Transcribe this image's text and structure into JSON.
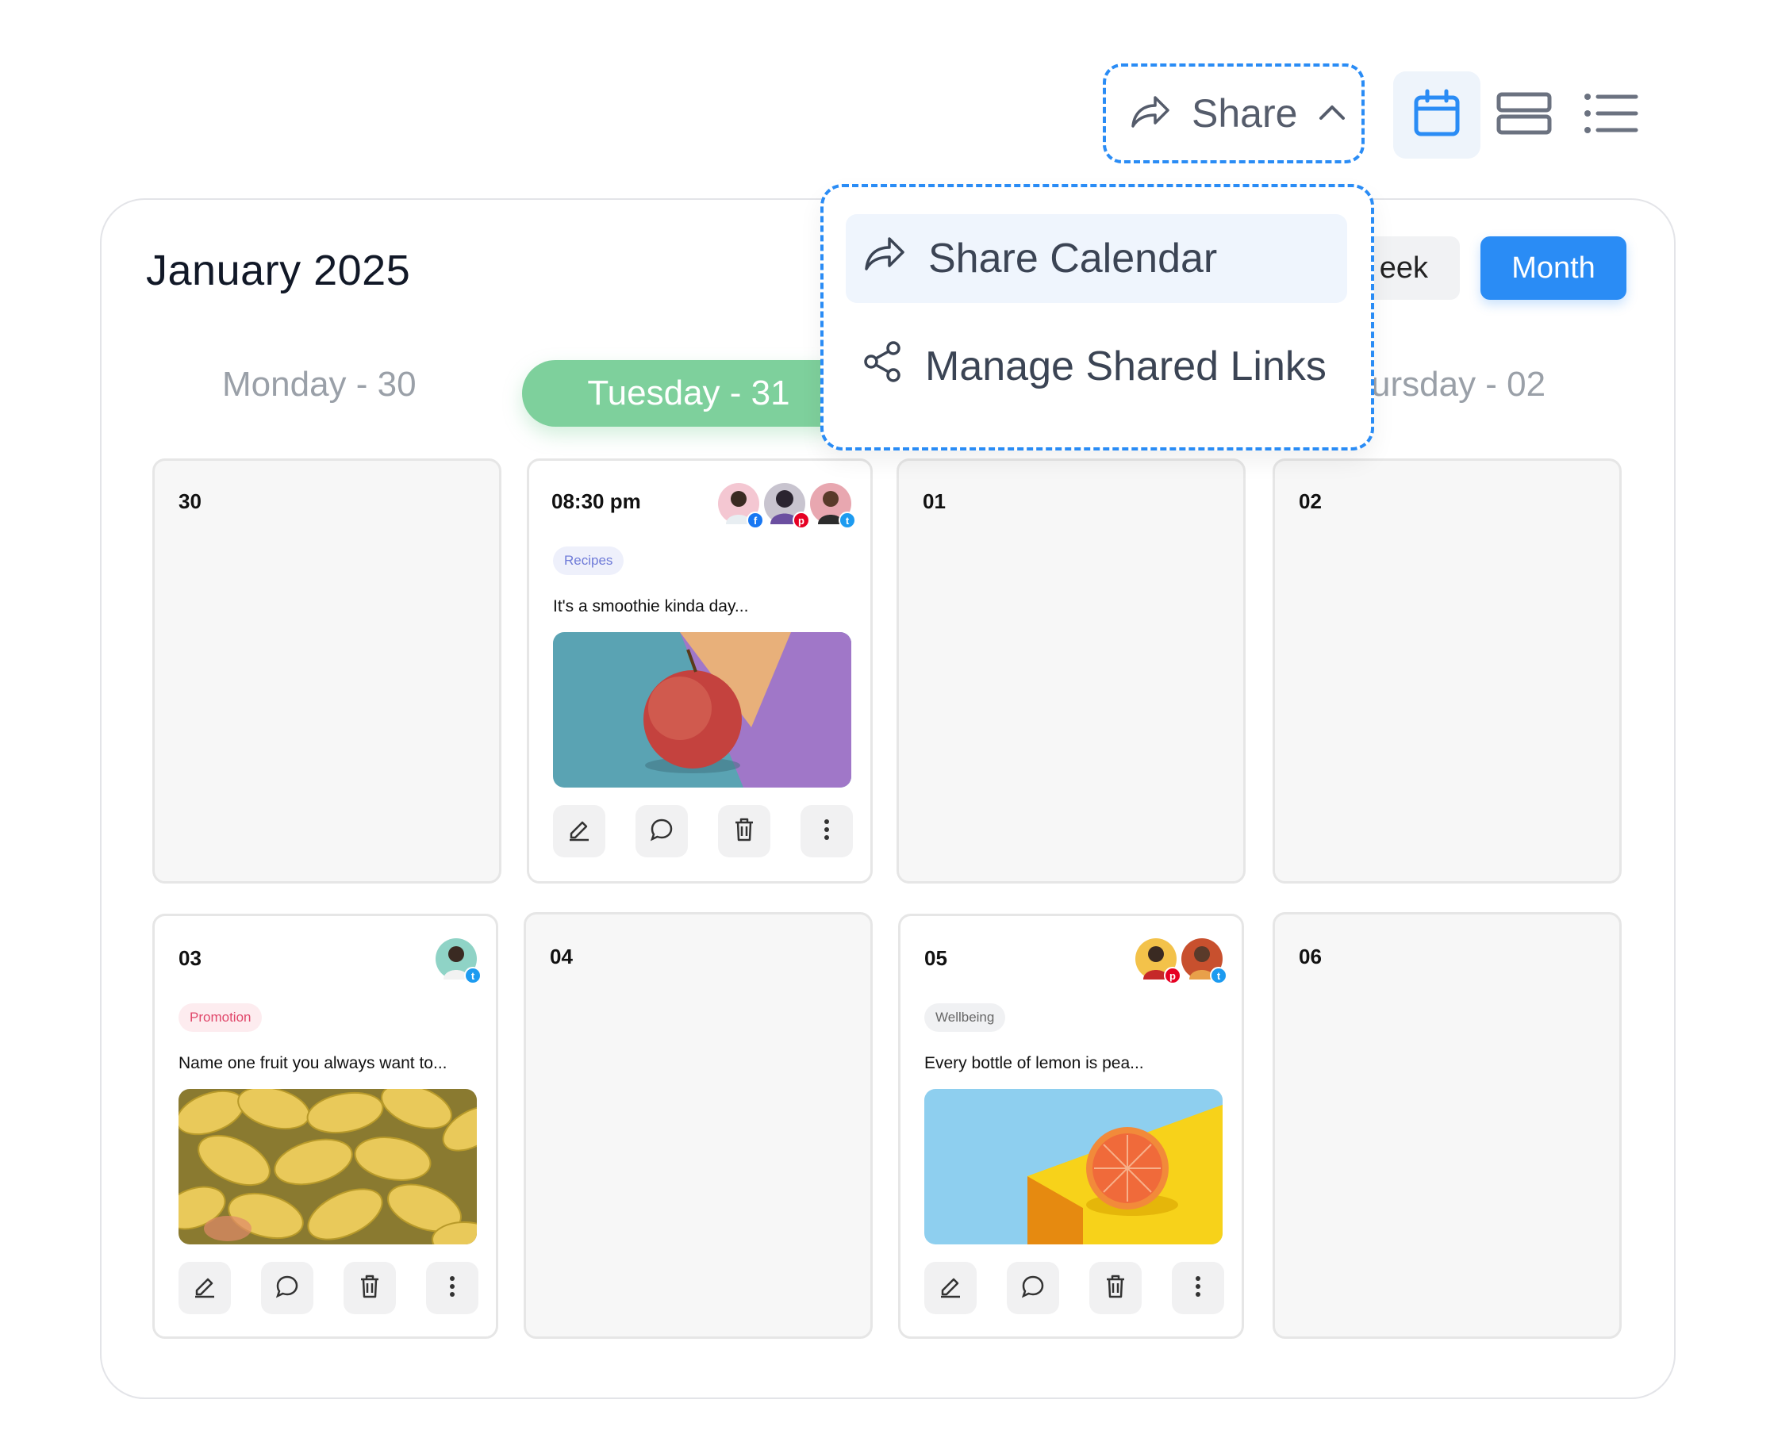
{
  "toolbar": {
    "share_label": "Share",
    "views": [
      "calendar-view",
      "stacked-view",
      "list-view"
    ],
    "active_view": "calendar-view"
  },
  "calendar": {
    "title": "January 2025",
    "view_toggle": {
      "week_label": "eek",
      "month_label": "Month",
      "active": "Month"
    },
    "day_headers": [
      "Monday - 30",
      "Tuesday - 31",
      "ursday - 02"
    ],
    "active_day": "Tuesday - 31",
    "cells": [
      {
        "date": "30"
      },
      {
        "date": "08:30 pm",
        "tag": "Recipes",
        "text": "It's a smoothie kinda day...",
        "image": "apple",
        "avatars": [
          {
            "network": "facebook",
            "color": "#1877f2"
          },
          {
            "network": "pinterest",
            "color": "#e60023"
          },
          {
            "network": "twitter",
            "color": "#1d9bf0"
          }
        ]
      },
      {
        "date": "01"
      },
      {
        "date": "02"
      },
      {
        "date": "03",
        "tag": "Promotion",
        "text": "Name one fruit you always want to...",
        "image": "mangoes",
        "avatars": [
          {
            "network": "twitter",
            "color": "#1d9bf0"
          }
        ]
      },
      {
        "date": "04"
      },
      {
        "date": "05",
        "tag": "Wellbeing",
        "text": "Every bottle of lemon is pea...",
        "image": "grapefruit",
        "avatars": [
          {
            "network": "pinterest",
            "color": "#e60023"
          },
          {
            "network": "twitter",
            "color": "#1d9bf0"
          }
        ]
      },
      {
        "date": "06"
      }
    ]
  },
  "share_menu": {
    "items": [
      {
        "label": "Share Calendar",
        "icon": "share-arrow-icon",
        "highlighted": true
      },
      {
        "label": "Manage Shared Links",
        "icon": "share-nodes-icon",
        "highlighted": false
      }
    ]
  },
  "colors": {
    "accent": "#2a8cf5",
    "active_day": "#7ed09c",
    "cell_bg": "#f7f7f7"
  }
}
